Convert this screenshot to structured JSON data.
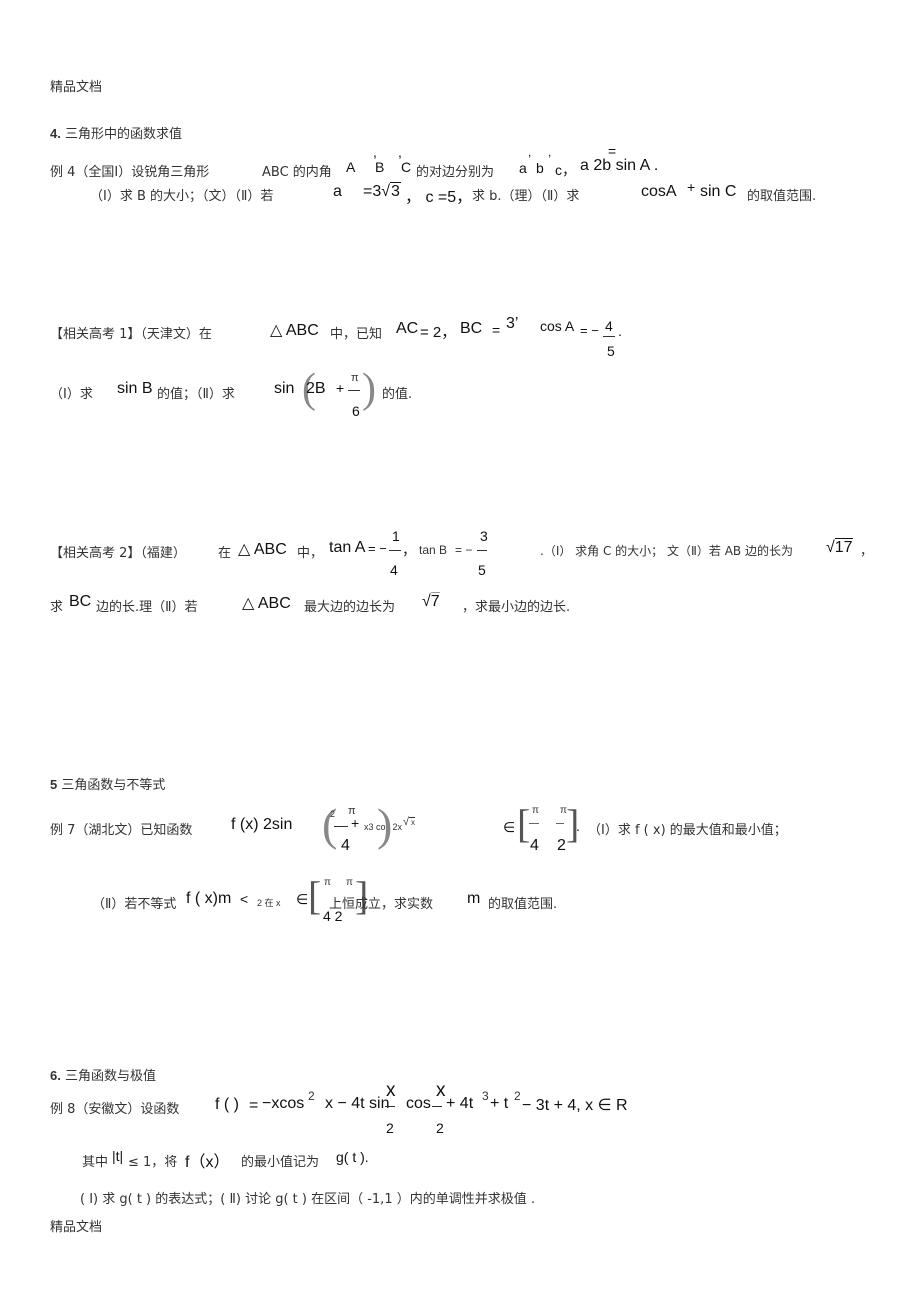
{
  "header_watermark": "精品文档",
  "footer_watermark": "精品文档",
  "sections": [
    {
      "number": "4.",
      "title": "三角形中的函数求值",
      "example": {
        "label": "例 4（全国Ⅰ）设锐角三角形",
        "text_1": "ABC 的内角",
        "vars_1": [
          "A",
          "B",
          "C"
        ],
        "text_2": "的对边分别为",
        "vars_2": [
          "a",
          "b",
          "c，"
        ],
        "commas": [
          ",",
          ","
        ],
        "eq_mark": "=",
        "formula": "a  2b sin A .",
        "line2_p1": "（Ⅰ）求  B 的大小；（文）（Ⅱ）若",
        "line2_a": "a",
        "line2_eq": "=3",
        "line2_sqrt": "3",
        "line2_c": "，  c =5，",
        "line2_p2": "求 b.（理）（Ⅱ）求",
        "line2_expr_1": "cosA",
        "line2_plus": "+",
        "line2_expr_2": "sin C",
        "line2_tail": "的取值范围."
      },
      "related": [
        {
          "label": "【相关高考  1】",
          "source": "（天津文）在",
          "tri": "△ ABC",
          "mid": "中，已知",
          "ac": "AC",
          "ac_val": "= 2，",
          "bc": "BC",
          "bc_eq": "=",
          "bc_val": "3’",
          "cos": "cos A",
          "cos_eq": "= −",
          "num": "4",
          "den": "5",
          "dot": ".",
          "line2_p1": "（Ⅰ）求",
          "line2_sinb": "sin B",
          "line2_p2": "的值；（Ⅱ）求",
          "line2_sin": "sin",
          "line2_inner": "2B",
          "line2_plus": "+",
          "line2_num": "π",
          "line2_den": "6",
          "line2_tail": "的值."
        },
        {
          "label": "【相关高考  2】",
          "source": "（福建）",
          "in": "在",
          "tri": "△ ABC",
          "mid": "中，",
          "tana": "tan A",
          "tana_eq": "= −",
          "tana_num": "1",
          "tana_den": "4",
          "sep": "，",
          "tanb": "tan B",
          "tanb_eq": "= −",
          "tanb_num": "3",
          "tanb_den": "5",
          "part1": ".（Ⅰ） 求角  C 的大小；  文（Ⅱ）若 AB 边的长为",
          "sqrt_val": "17",
          "tail_comma": "，",
          "line2_p1": "求",
          "line2_bc": "BC",
          "line2_p2": "边的长.理（Ⅱ）若",
          "line2_tri": "△ ABC",
          "line2_p3": "最大边的边长为",
          "line2_sqrt": "7",
          "line2_tail": "，求最小边的边长."
        }
      ]
    },
    {
      "number": "5",
      "title": "三角函数与不等式",
      "example": {
        "label": "例 7（湖北文）已知函数",
        "func": "f (x)  2sin",
        "sup2": "2",
        "pi": "π",
        "plus": "+",
        "four": "4",
        "tail_small": "x3 cos 2x",
        "sqrt_x": "x",
        "in": "∈",
        "int_num_1": "π",
        "int_num_2": "π",
        "int_den_1": "4",
        "int_den_2": "2",
        "dot": ".",
        "part1": "（Ⅰ）求 f ( x) 的最大值和最小值；",
        "line2_p1": "（Ⅱ）若不等式",
        "line2_f": "f ( x)m",
        "line2_lt": "<",
        "line2_small": "2 在 x",
        "line2_in": "∈",
        "line2_pi_1": "π",
        "line2_pi_2": "π",
        "line2_den": "4 2",
        "line2_p2": "上恒成立，求实数",
        "line2_m": "m",
        "line2_tail": "的取值范围."
      }
    },
    {
      "number": "6.",
      "title": "三角函数与极值",
      "example": {
        "label": "例 8（安徽文）设函数",
        "f": "f (   )",
        "eq": "=",
        "p1": "−xcos",
        "sup2": "2",
        "p2": "x − 4t sin",
        "x_num_1": "x",
        "x_den_1": "2",
        "cos": "cos",
        "x_num_2": "x",
        "x_den_2": "2",
        "p3": "+ 4t",
        "sup3": "3",
        "p4": "+ t",
        "sup2b": "2",
        "p5": "− 3t + 4, x ∈ R",
        "line2_p1": "其中",
        "line2_abs": "|t|",
        "line2_le": "≤ 1，将",
        "line2_f": "f（x）",
        "line2_p2": "的最小值记为",
        "line2_g": "g( t ).",
        "line3": "( Ⅰ) 求 g( t ) 的表达式；( Ⅱ) 讨论 g( t ) 在区间（ -1,1   ）内的单调性并求极值   ."
      }
    }
  ]
}
